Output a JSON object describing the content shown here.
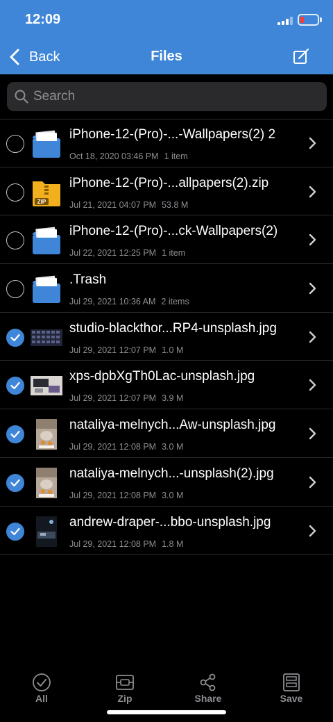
{
  "status": {
    "time": "12:09"
  },
  "nav": {
    "back_label": "Back",
    "title": "Files",
    "edit_icon": "compose-icon"
  },
  "search": {
    "placeholder": "Search",
    "value": ""
  },
  "colors": {
    "accent": "#3f86d8",
    "battery_low": "#ff3b30",
    "folder": "#4a8fe0",
    "zip": "#f2b01e"
  },
  "files": [
    {
      "name": "iPhone-12-(Pro)-...-Wallpapers(2) 2",
      "date": "Oct 18, 2020 03:46 PM",
      "size": "1 item",
      "kind": "folder",
      "selected": false
    },
    {
      "name": "iPhone-12-(Pro)-...allpapers(2).zip",
      "date": "Jul 21, 2021 04:07 PM",
      "size": "53.8 M",
      "kind": "zip",
      "selected": false
    },
    {
      "name": "iPhone-12-(Pro)-...ck-Wallpapers(2)",
      "date": "Jul 22, 2021 12:25 PM",
      "size": "1 item",
      "kind": "folder",
      "selected": false
    },
    {
      "name": ".Trash",
      "date": "Jul 29, 2021 10:36 AM",
      "size": "2 items",
      "kind": "folder",
      "selected": false
    },
    {
      "name": "studio-blackthor...RP4-unsplash.jpg",
      "date": "Jul 29, 2021 12:07 PM",
      "size": "1.0 M",
      "kind": "image-grid",
      "selected": true
    },
    {
      "name": "xps-dpbXgTh0Lac-unsplash.jpg",
      "date": "Jul 29, 2021 12:07 PM",
      "size": "3.9 M",
      "kind": "image-desk",
      "selected": true
    },
    {
      "name": "nataliya-melnych...Aw-unsplash.jpg",
      "date": "Jul 29, 2021 12:08 PM",
      "size": "3.0 M",
      "kind": "image-food",
      "selected": true
    },
    {
      "name": "nataliya-melnych...-unsplash(2).jpg",
      "date": "Jul 29, 2021 12:08 PM",
      "size": "3.0 M",
      "kind": "image-food",
      "selected": true
    },
    {
      "name": "andrew-draper-...bbo-unsplash.jpg",
      "date": "Jul 29, 2021 12:08 PM",
      "size": "1.8 M",
      "kind": "image-dark",
      "selected": true
    }
  ],
  "toolbar": {
    "all": "All",
    "zip": "Zip",
    "share": "Share",
    "save": "Save"
  }
}
